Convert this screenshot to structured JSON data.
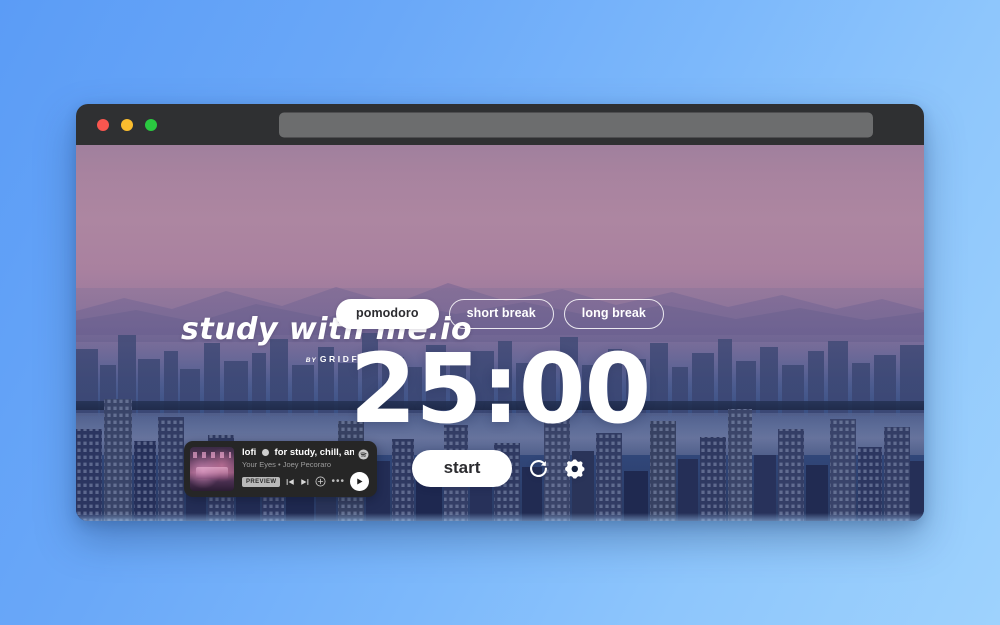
{
  "browser": {
    "traffic_lights": [
      {
        "name": "close",
        "color": "#f9564f"
      },
      {
        "name": "minimize",
        "color": "#fbbd2e"
      },
      {
        "name": "maximize",
        "color": "#2ac940"
      }
    ],
    "address_bar": {
      "value": "",
      "placeholder": ""
    }
  },
  "site": {
    "logo": "study with me.io",
    "logo_by": "BY",
    "logo_brand": "GRIDFITI"
  },
  "tabs": [
    {
      "label": "pomodoro",
      "active": true
    },
    {
      "label": "short break",
      "active": false
    },
    {
      "label": "long break",
      "active": false
    }
  ],
  "timer": {
    "display": "25:00",
    "minutes": "25",
    "seconds": "00"
  },
  "controls": {
    "start_label": "start",
    "reset_icon": "reset-icon",
    "settings_icon": "gear-icon"
  },
  "spotify": {
    "title": "lofi  for study, chill, and mo",
    "subtitle": "Your Eyes • Joey Pecoraro",
    "preview_badge": "PREVIEW",
    "more_label": "•••",
    "icons": {
      "brand": "spotify-logo-icon",
      "previous": "previous-track-icon",
      "next": "next-track-icon",
      "add": "add-to-playlist-icon",
      "play": "play-icon"
    }
  },
  "colors": {
    "accent_white": "#ffffff",
    "chrome": "#2f3032",
    "urlbar": "#6c6d6e",
    "spotify_bg": "#262626",
    "spotify_green": "#1db954",
    "desktop_blue": "#6aa8f8"
  }
}
